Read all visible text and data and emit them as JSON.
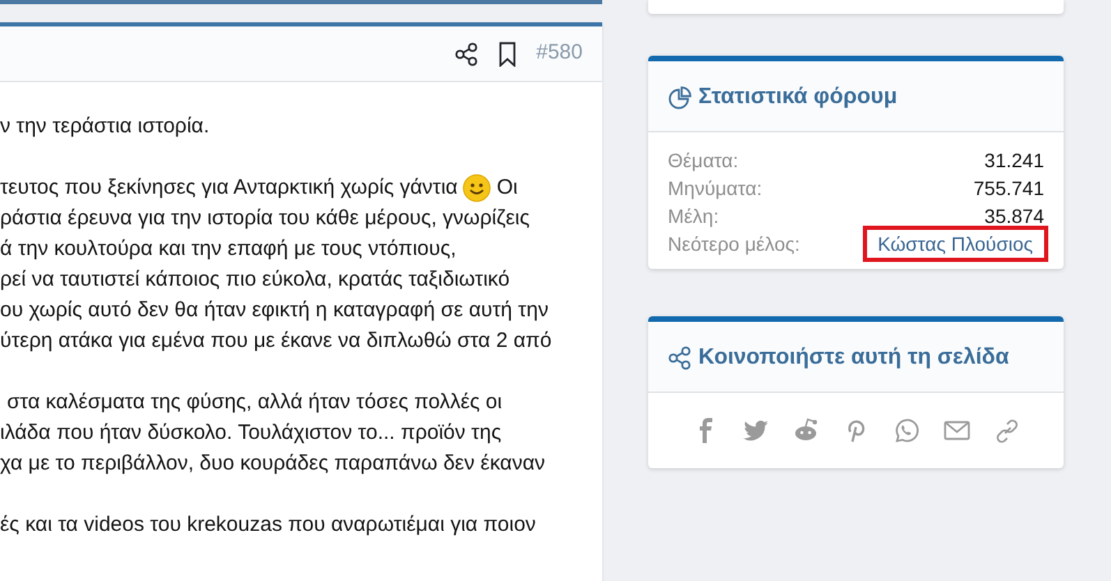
{
  "post": {
    "number": "#580",
    "paragraphs": [
      {
        "lines": [
          {
            "text": "ν την τεράστια ιστορία."
          }
        ]
      },
      {
        "lines": [
          {
            "text": "τευτος που ξεκίνησες για Ανταρκτική χωρίς γάντια",
            "emoji": true,
            "text_after": "Οι"
          },
          {
            "text": "ράστια έρευνα για την ιστορία του κάθε μέρους, γνωρίζεις"
          },
          {
            "text": "ά την κουλτούρα και την επαφή με τους ντόπιους,"
          },
          {
            "text": "ρεί να ταυτιστεί κάποιος πιο εύκολα, κρατάς ταξιδιωτικό"
          },
          {
            "text": "ου χωρίς αυτό δεν θα ήταν εφικτή η καταγραφή σε αυτή την"
          },
          {
            "text": "ύτερη ατάκα για εμένα που με έκανε να διπλωθώ στα 2 από"
          }
        ]
      },
      {
        "lines": [
          {
            "text": "στα καλέσματα της φύσης, αλλά ήταν τόσες πολλές οι",
            "indent": true
          },
          {
            "text": "ιλάδα που ήταν δύσκολο. Τουλάχιστον το... προϊόν της"
          },
          {
            "text": "χα με το περιβάλλον, δυο κουράδες παραπάνω δεν έκαναν"
          }
        ]
      },
      {
        "lines": [
          {
            "text": "ές και τα videos του krekouzas που αναρωτιέμαι για ποιον"
          }
        ]
      }
    ]
  },
  "stats": {
    "title": "Στατιστικά φόρουμ",
    "rows": [
      {
        "label": "Θέματα:",
        "value": "31.241",
        "kind": "text"
      },
      {
        "label": "Μηνύματα:",
        "value": "755.741",
        "kind": "text"
      },
      {
        "label": "Μέλη:",
        "value": "35.874",
        "kind": "text"
      },
      {
        "label": "Νεότερο μέλος:",
        "value": "Κώστας Πλούσιος",
        "kind": "link",
        "highlighted": true
      }
    ]
  },
  "share": {
    "title": "Κοινοποιήστε αυτή τη σελίδα"
  }
}
